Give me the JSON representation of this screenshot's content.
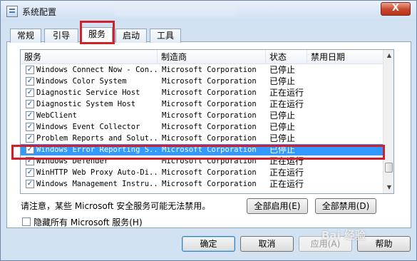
{
  "window": {
    "title": "系统配置",
    "close_label": "X"
  },
  "tabs": [
    {
      "label": "常规"
    },
    {
      "label": "引导"
    },
    {
      "label": "服务"
    },
    {
      "label": "启动"
    },
    {
      "label": "工具"
    }
  ],
  "active_tab": "服务",
  "list": {
    "headers": [
      "服务",
      "制造商",
      "状态",
      "禁用日期"
    ],
    "rows": [
      {
        "name": "Windows Connect Now - Con...",
        "manufacturer": "Microsoft Corporation",
        "status": "已停止",
        "checked": true
      },
      {
        "name": "Windows Color System",
        "manufacturer": "Microsoft Corporation",
        "status": "已停止",
        "checked": true
      },
      {
        "name": "Diagnostic Service Host",
        "manufacturer": "Microsoft Corporation",
        "status": "正在运行",
        "checked": true
      },
      {
        "name": "Diagnostic System Host",
        "manufacturer": "Microsoft Corporation",
        "status": "正在运行",
        "checked": true
      },
      {
        "name": "WebClient",
        "manufacturer": "Microsoft Corporation",
        "status": "已停止",
        "checked": true
      },
      {
        "name": "Windows Event Collector",
        "manufacturer": "Microsoft Corporation",
        "status": "已停止",
        "checked": true
      },
      {
        "name": "Problem Reports and Solut...",
        "manufacturer": "Microsoft Corporation",
        "status": "已停止",
        "checked": true
      },
      {
        "name": "Windows Error Reporting S...",
        "manufacturer": "Microsoft Corporation",
        "status": "已停止",
        "checked": true,
        "selected": true
      },
      {
        "name": "Windows Defender",
        "manufacturer": "Microsoft Corporation",
        "status": "正在运行",
        "checked": true
      },
      {
        "name": "WinHTTP Web Proxy Auto-Di...",
        "manufacturer": "Microsoft Corporation",
        "status": "正在运行",
        "checked": true
      },
      {
        "name": "Windows Management Instru...",
        "manufacturer": "Microsoft Corporation",
        "status": "正在运行",
        "checked": true
      }
    ]
  },
  "notice": "请注意，某些 Microsoft 安全服务可能无法禁用。",
  "buttons": {
    "enable_all": "全部启用(E)",
    "disable_all": "全部禁用(D)",
    "ok": "确定",
    "cancel": "取消",
    "apply": "应用(A)",
    "help": "帮助"
  },
  "hide_ms_label": "隐藏所有 Microsoft 服务(H)",
  "hide_ms_checked": false,
  "watermark": "Bai 经验",
  "colors": {
    "highlight_box": "#d0202b",
    "selection": "#3399ff"
  }
}
